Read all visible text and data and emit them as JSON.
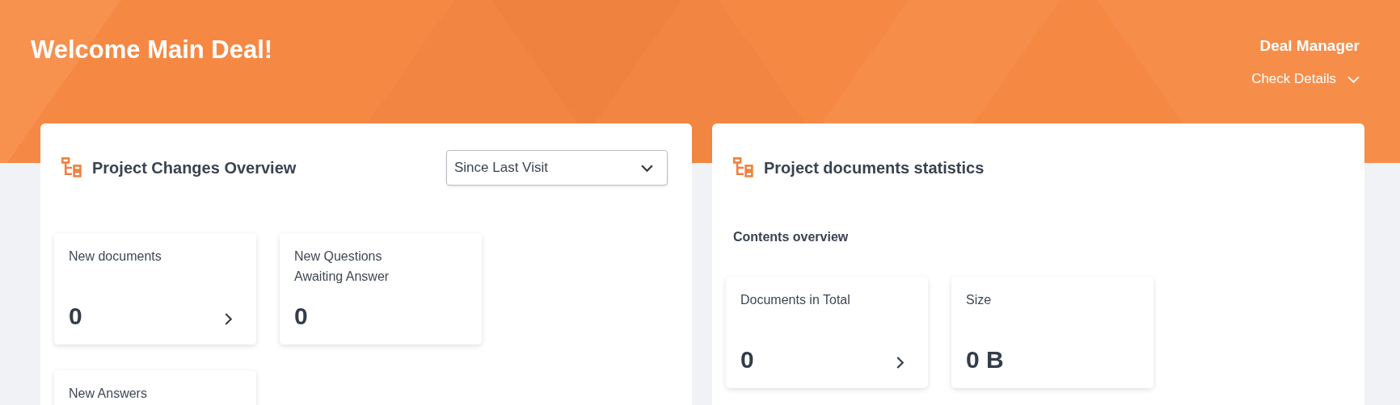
{
  "header": {
    "greeting": "Welcome Main Deal!",
    "role": "Deal Manager",
    "details_link": "Check Details"
  },
  "changes_panel": {
    "title": "Project Changes Overview",
    "period_select": {
      "value": "Since Last Visit"
    },
    "stats": [
      {
        "label": "New documents",
        "value": "0",
        "has_link": true
      },
      {
        "label": "New Questions Awaiting Answer",
        "value": "0",
        "has_link": false
      },
      {
        "label": "New Answers"
      }
    ]
  },
  "documents_panel": {
    "title": "Project documents statistics",
    "section_title": "Contents overview",
    "stats": [
      {
        "label": "Documents in Total",
        "value": "0",
        "has_link": true
      },
      {
        "label": "Size",
        "value": "0 B",
        "has_link": false
      }
    ]
  }
}
